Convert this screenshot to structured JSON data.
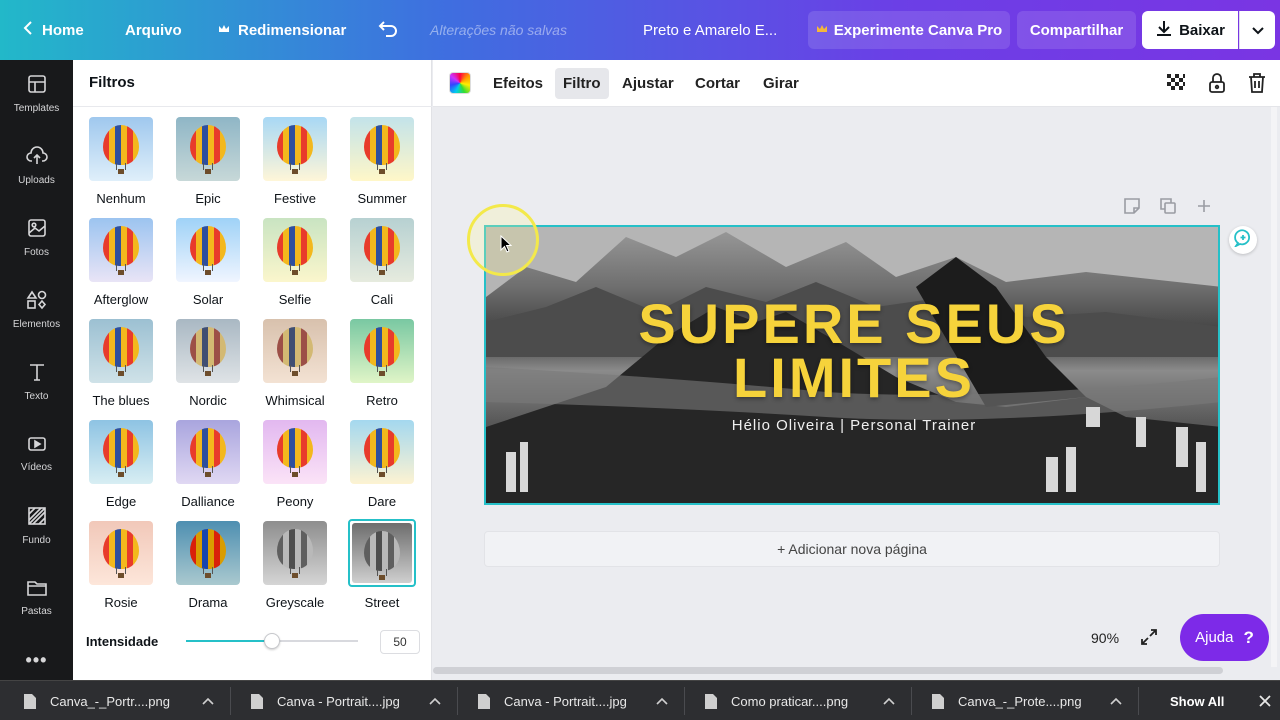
{
  "topbar": {
    "home": "Home",
    "file": "Arquivo",
    "resize": "Redimensionar",
    "unsaved": "Alterações não salvas",
    "doc_title": "Preto e Amarelo E...",
    "pro": "Experimente Canva Pro",
    "share": "Compartilhar",
    "download": "Baixar"
  },
  "rail": [
    {
      "label": "Templates",
      "icon": "templates-icon"
    },
    {
      "label": "Uploads",
      "icon": "upload-icon"
    },
    {
      "label": "Fotos",
      "icon": "photos-icon"
    },
    {
      "label": "Elementos",
      "icon": "elements-icon"
    },
    {
      "label": "Texto",
      "icon": "text-icon"
    },
    {
      "label": "Vídeos",
      "icon": "video-icon"
    },
    {
      "label": "Fundo",
      "icon": "background-icon"
    },
    {
      "label": "Pastas",
      "icon": "folder-icon"
    }
  ],
  "panel": {
    "title": "Filtros",
    "filters": [
      "Nenhum",
      "Epic",
      "Festive",
      "Summer",
      "Afterglow",
      "Solar",
      "Selfie",
      "Cali",
      "The blues",
      "Nordic",
      "Whimsical",
      "Retro",
      "Edge",
      "Dalliance",
      "Peony",
      "Dare",
      "Rosie",
      "Drama",
      "Greyscale",
      "Street"
    ],
    "selected": "Street",
    "intensity_label": "Intensidade",
    "intensity_value": "50"
  },
  "toolbar": {
    "effects": "Efeitos",
    "filter": "Filtro",
    "adjust": "Ajustar",
    "crop": "Cortar",
    "rotate": "Girar"
  },
  "canvas": {
    "headline_line1": "SUPERE SEUS",
    "headline_line2": "LIMITES",
    "subline": "Hélio Oliveira | Personal Trainer",
    "add_page": "+ Adicionar nova página",
    "zoom": "90%",
    "help": "Ajuda",
    "help_mark": "?"
  },
  "downloads": {
    "files": [
      "Canva_-_Portr....png",
      "Canva - Portrait....jpg",
      "Canva - Portrait....jpg",
      "Como praticar....png",
      "Canva_-_Prote....png"
    ],
    "show_all": "Show All"
  },
  "colors": {
    "accent_teal": "#25c0c8",
    "headline_yellow": "#f6d33b",
    "help_purple": "#7d2ae8"
  }
}
